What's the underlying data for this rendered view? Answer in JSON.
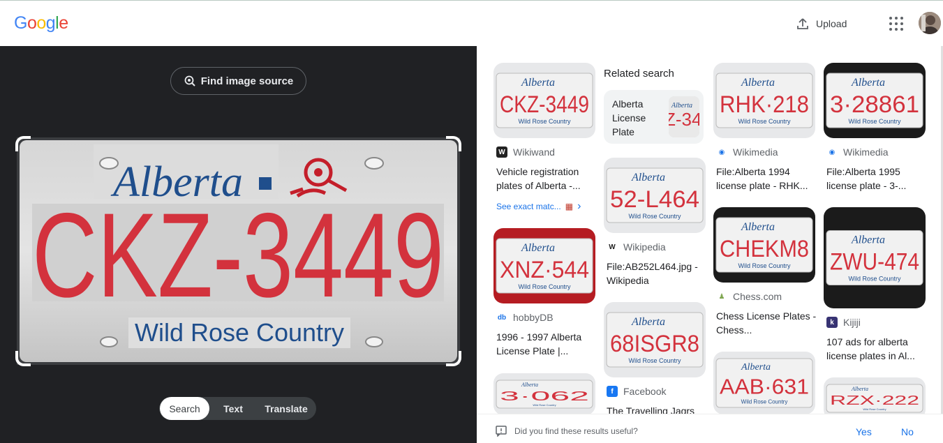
{
  "header": {
    "logo_letters": [
      "G",
      "o",
      "o",
      "g",
      "l",
      "e"
    ],
    "logo_colors": [
      "#4285F4",
      "#EA4335",
      "#FBBC05",
      "#4285F4",
      "#34A853",
      "#EA4335"
    ],
    "upload_label": "Upload",
    "upload_icon": "upload-icon",
    "apps_icon": "apps-grid-icon",
    "avatar": "account-avatar"
  },
  "lens": {
    "find_source_label": "Find image source",
    "plate": {
      "province": "Alberta",
      "number": "CKZ-3449",
      "slogan": "Wild Rose Country"
    },
    "tabs": [
      {
        "label": "Search",
        "active": true
      },
      {
        "label": "Text",
        "active": false
      },
      {
        "label": "Translate",
        "active": false
      }
    ]
  },
  "results": {
    "related_search_title": "Related search",
    "related_search_item": "Alberta License Plate",
    "cards": [
      {
        "source": "Wikiwand",
        "title": "Vehicle registration plates of Alberta -...",
        "see_exact": "See exact matc...",
        "plate": "CKZ-3449"
      },
      {
        "source": "Wikimedia",
        "title": "File:Alberta 1994 license plate - RHK...",
        "plate": "RHK·218"
      },
      {
        "source": "Wikimedia",
        "title": "File:Alberta 1995 license plate - 3-...",
        "plate": "3·28861"
      },
      {
        "source": "Wikipedia",
        "title": "File:AB252L464.jpg - Wikipedia",
        "plate": "52-L464"
      },
      {
        "source": "hobbyDB",
        "title": "1996 - 1997 Alberta License Plate |...",
        "plate": "XNZ·544"
      },
      {
        "source": "Chess.com",
        "title": "Chess License Plates - Chess...",
        "plate": "CHEKM8"
      },
      {
        "source": "Kijiji",
        "title": "107 ads for alberta license plates in Al...",
        "plate": "ZWU-474"
      },
      {
        "source": "Facebook",
        "title": "The Travelling Jagrs",
        "plate": "68ISGR8"
      },
      {
        "source": "",
        "title": "",
        "plate": "3·062"
      },
      {
        "source": "",
        "title": "",
        "plate": "AAB·631"
      },
      {
        "source": "",
        "title": "",
        "plate": "RZX·222"
      }
    ]
  },
  "feedback": {
    "question": "Did you find these results useful?",
    "yes": "Yes",
    "no": "No"
  }
}
